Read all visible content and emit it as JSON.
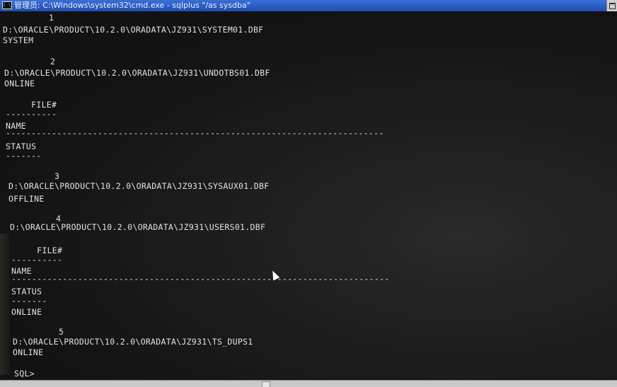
{
  "window": {
    "title": "管理员: C:\\Windows\\system32\\cmd.exe - sqlplus  \"/as sysdba\"",
    "icon_label": "C:\\"
  },
  "console": {
    "lines": [
      "         1",
      "D:\\ORACLE\\PRODUCT\\10.2.0\\ORADATA\\JZ931\\SYSTEM01.DBF",
      "SYSTEM",
      "         2",
      "D:\\ORACLE\\PRODUCT\\10.2.0\\ORADATA\\JZ931\\UNDOTBS01.DBF",
      "ONLINE",
      "     FILE#",
      "----------",
      "NAME",
      "--------------------------------------------------------------------------",
      "STATUS",
      "-------",
      "         3",
      "D:\\ORACLE\\PRODUCT\\10.2.0\\ORADATA\\JZ931\\SYSAUX01.DBF",
      "OFFLINE",
      "         4",
      "D:\\ORACLE\\PRODUCT\\10.2.0\\ORADATA\\JZ931\\USERS01.DBF",
      "     FILE#",
      "----------",
      "NAME",
      "--------------------------------------------------------------------------",
      "STATUS",
      "-------",
      "ONLINE",
      "         5",
      "D:\\ORACLE\\PRODUCT\\10.2.0\\ORADATA\\JZ931\\TS_DUPS1",
      "ONLINE",
      "SQL>"
    ]
  }
}
